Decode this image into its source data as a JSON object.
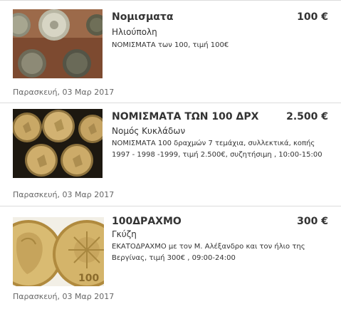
{
  "listings": [
    {
      "title": "Νομισματα",
      "price": "100 €",
      "location": "Ηλιούπολη",
      "description": "ΝΟΜΙΣΜΑΤΑ των 100, τιμή 100€",
      "date": "Παρασκευή, 03 Μαρ 2017",
      "image": "coins-photo"
    },
    {
      "title": "ΝΟΜΙΣΜΑΤΑ ΤΩΝ 100 ΔΡΧ",
      "price": "2.500 €",
      "location": "Νομός Κυκλάδων",
      "description": "ΝΟΜΙΣΜΑΤΑ 100 δραχμών 7 τεμάχια, συλλεκτικά, κοπής 1997 - 1998 -1999, τιμή 2.500€, συζητήσιμη , 10:00-15:00",
      "date": "Παρασκευή, 03 Μαρ 2017",
      "image": "gold-coins-photo"
    },
    {
      "title": "100ΔΡΑΧΜΟ",
      "price": "300 €",
      "location": "Γκύζη",
      "description": "ΕΚΑΤΟΔΡΑΧΜΟ με τον Μ. Αλέξανδρο και τον ήλιο της Βεργίνας, τιμή 300€ , 09:00-24:00",
      "date": "Παρασκευή, 03 Μαρ 2017",
      "image": "drachma-coin-photo"
    }
  ]
}
